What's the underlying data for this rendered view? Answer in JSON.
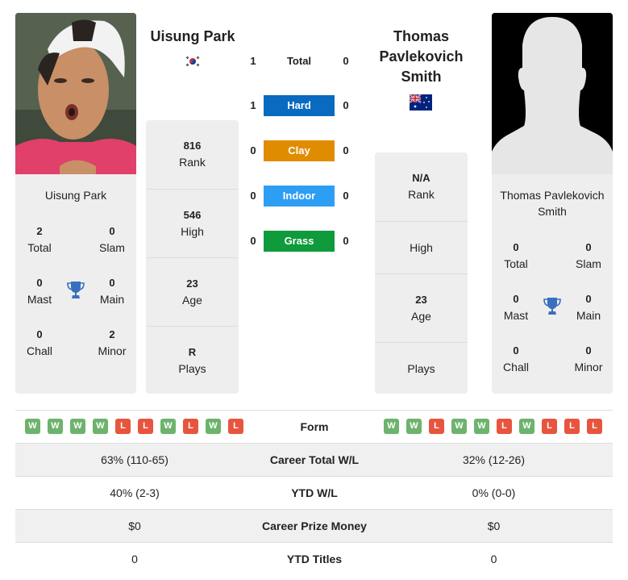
{
  "player1": {
    "name": "Uisung Park",
    "country": "South Korea",
    "flag_icon": "flag-south-korea",
    "photo": "player-photo",
    "titles": {
      "total": {
        "value": "2",
        "label": "Total"
      },
      "slam": {
        "value": "0",
        "label": "Slam"
      },
      "mast": {
        "value": "0",
        "label": "Mast"
      },
      "main": {
        "value": "0",
        "label": "Main"
      },
      "chall": {
        "value": "0",
        "label": "Chall"
      },
      "minor": {
        "value": "2",
        "label": "Minor"
      }
    },
    "stats": {
      "rank": {
        "value": "816",
        "label": "Rank"
      },
      "high": {
        "value": "546",
        "label": "High"
      },
      "age": {
        "value": "23",
        "label": "Age"
      },
      "plays": {
        "value": "R",
        "label": "Plays"
      }
    },
    "form": [
      "W",
      "W",
      "W",
      "W",
      "L",
      "L",
      "W",
      "L",
      "W",
      "L"
    ]
  },
  "player2": {
    "name": "Thomas Pavlekovich Smith",
    "name_heading": [
      "Thomas",
      "Pavlekovich",
      "Smith"
    ],
    "country": "Australia",
    "flag_icon": "flag-australia",
    "photo": "silhouette-placeholder",
    "titles": {
      "total": {
        "value": "0",
        "label": "Total"
      },
      "slam": {
        "value": "0",
        "label": "Slam"
      },
      "mast": {
        "value": "0",
        "label": "Mast"
      },
      "main": {
        "value": "0",
        "label": "Main"
      },
      "chall": {
        "value": "0",
        "label": "Chall"
      },
      "minor": {
        "value": "0",
        "label": "Minor"
      }
    },
    "stats": {
      "rank": {
        "value": "N/A",
        "label": "Rank"
      },
      "high": {
        "value": "",
        "label": "High"
      },
      "age": {
        "value": "23",
        "label": "Age"
      },
      "plays": {
        "value": "",
        "label": "Plays"
      }
    },
    "form": [
      "W",
      "W",
      "L",
      "W",
      "W",
      "L",
      "W",
      "L",
      "L",
      "L"
    ]
  },
  "h2h": [
    {
      "surface": "Total",
      "p1": "1",
      "p2": "0",
      "color": ""
    },
    {
      "surface": "Hard",
      "p1": "1",
      "p2": "0",
      "color": "#0a6abf"
    },
    {
      "surface": "Clay",
      "p1": "0",
      "p2": "0",
      "color": "#e08c00"
    },
    {
      "surface": "Indoor",
      "p1": "0",
      "p2": "0",
      "color": "#2e9ef4"
    },
    {
      "surface": "Grass",
      "p1": "0",
      "p2": "0",
      "color": "#0f9a3c"
    }
  ],
  "form_label": "Form",
  "comparison": [
    {
      "label": "Career Total W/L",
      "p1": "63% (110-65)",
      "p2": "32% (12-26)"
    },
    {
      "label": "YTD W/L",
      "p1": "40% (2-3)",
      "p2": "0% (0-0)"
    },
    {
      "label": "Career Prize Money",
      "p1": "$0",
      "p2": "$0"
    },
    {
      "label": "YTD Titles",
      "p1": "0",
      "p2": "0"
    }
  ],
  "colors": {
    "win": "#6db36d",
    "loss": "#e8553e",
    "trophy": "#3a6fbf",
    "card_bg": "#eeeeee"
  }
}
